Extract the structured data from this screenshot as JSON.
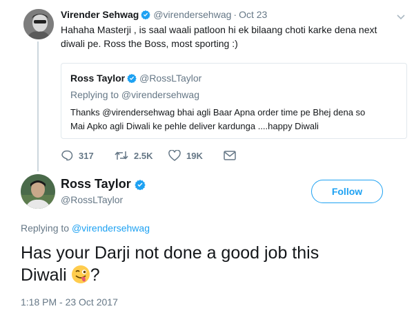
{
  "parent_tweet": {
    "author_name": "Virender Sehwag",
    "author_handle": "@virendersehwag",
    "separator": "·",
    "date": "Oct 23",
    "text_line1": "Hahaha Masterji , is saal waali patloon hi ek bilaang choti karke dena next",
    "text_line2": "diwali pe. Ross the Boss, most sporting :)",
    "actions": {
      "reply_count": "317",
      "retweet_count": "2.5K",
      "like_count": "19K"
    }
  },
  "quoted_tweet": {
    "author_name": "Ross Taylor",
    "author_handle": "@RossLTaylor",
    "replying_to": "Replying to @virendersehwag",
    "text_line1": "Thanks @virendersehwag bhai agli Baar Apna order time pe Bhej dena so",
    "text_line2": "Mai Apko agli Diwali ke pehle deliver  kardunga ....happy Diwali"
  },
  "main_tweet": {
    "author_name": "Ross Taylor",
    "author_handle": "@RossLTaylor",
    "follow_label": "Follow",
    "replying_prefix": "Replying to",
    "replying_handle": "@virendersehwag",
    "text_line1": "Has your Darji not done a good job this",
    "text_line2": "Diwali",
    "text_suffix": "?",
    "emoji": "winking-face-with-tongue",
    "timestamp": "1:18 PM - 23 Oct 2017"
  },
  "colors": {
    "accent": "#1da1f2",
    "secondary_text": "#657786",
    "border": "#e1e8ed"
  }
}
